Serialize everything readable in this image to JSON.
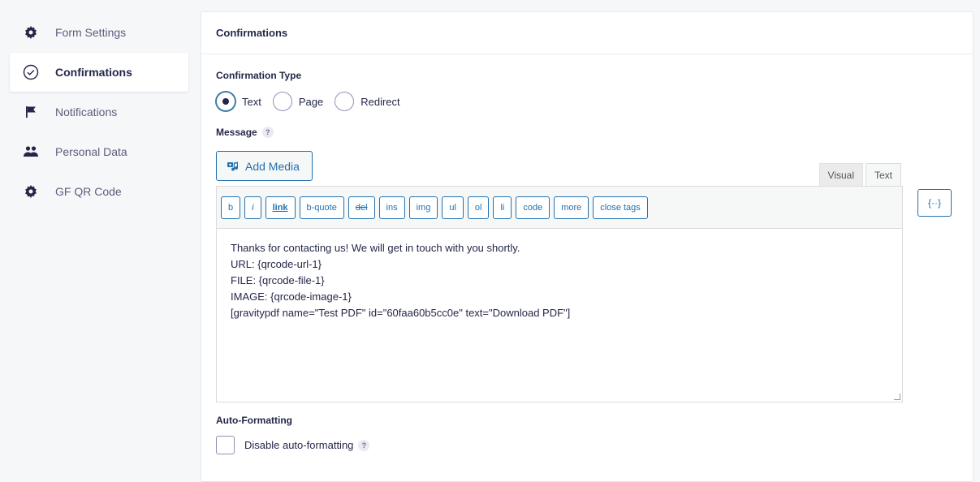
{
  "sidebar": {
    "items": [
      {
        "label": "Form Settings",
        "icon": "gear-icon",
        "active": false
      },
      {
        "label": "Confirmations",
        "icon": "check-circle-icon",
        "active": true
      },
      {
        "label": "Notifications",
        "icon": "flag-icon",
        "active": false
      },
      {
        "label": "Personal Data",
        "icon": "users-icon",
        "active": false
      },
      {
        "label": "GF QR Code",
        "icon": "gear-icon",
        "active": false
      }
    ]
  },
  "panel": {
    "title": "Confirmations",
    "confirmation_type": {
      "label": "Confirmation Type",
      "options": [
        {
          "label": "Text",
          "selected": true
        },
        {
          "label": "Page",
          "selected": false
        },
        {
          "label": "Redirect",
          "selected": false
        }
      ]
    },
    "message": {
      "label": "Message",
      "help": "?",
      "add_media_label": "Add Media",
      "tabs": {
        "visual": "Visual",
        "text": "Text"
      },
      "quicktags": [
        "b",
        "i",
        "link",
        "b-quote",
        "del",
        "ins",
        "img",
        "ul",
        "ol",
        "li",
        "code",
        "more",
        "close tags"
      ],
      "merge_tag_label": "{··}",
      "content": [
        "Thanks for contacting us! We will get in touch with you shortly.",
        "",
        "URL: {qrcode-url-1}",
        "FILE: {qrcode-file-1}",
        "IMAGE: {qrcode-image-1}",
        "",
        "[gravitypdf name=\"Test PDF\" id=\"60faa60b5cc0e\" text=\"Download PDF\"]"
      ]
    },
    "auto_formatting": {
      "label": "Auto-Formatting",
      "checkbox_label": "Disable auto-formatting",
      "help": "?",
      "checked": false
    }
  },
  "colors": {
    "accent": "#2271b1",
    "text": "#242748"
  }
}
